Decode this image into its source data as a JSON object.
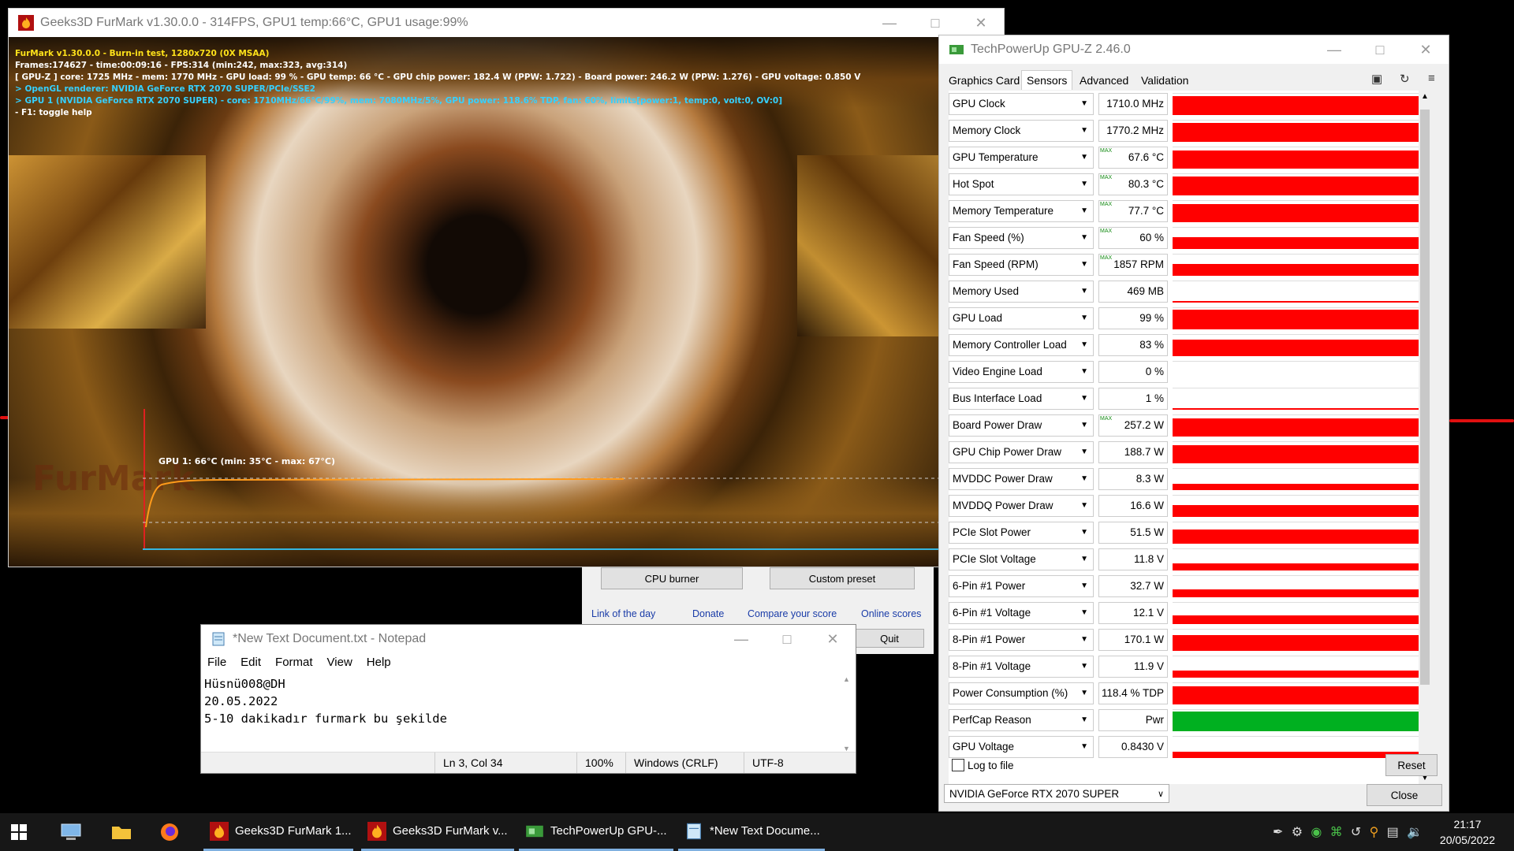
{
  "furmark": {
    "title": "Geeks3D FurMark v1.30.0.0 - 314FPS, GPU1 temp:66°C, GPU1 usage:99%",
    "hud": [
      "FurMark v1.30.0.0 - Burn-in test, 1280x720 (0X MSAA)",
      "Frames:174627 - time:00:09:16 - FPS:314 (min:242, max:323, avg:314)",
      "[ GPU-Z ] core: 1725 MHz - mem: 1770 MHz - GPU load: 99 % - GPU temp: 66 °C - GPU chip power: 182.4 W (PPW: 1.722) - Board power: 246.2 W (PPW: 1.276) - GPU voltage: 0.850 V",
      "> OpenGL renderer: NVIDIA GeForce RTX 2070 SUPER/PCIe/SSE2",
      "> GPU 1 (NVIDIA GeForce RTX 2070 SUPER) - core: 1710MHz/66°C/99%, mem: 7080MHz/5%, GPU power: 118.6% TDP, fan: 60%, limits[power:1, temp:0, volt:0, OV:0]",
      "- F1: toggle help"
    ],
    "graph_label": "GPU 1: 66°C (min: 35°C - max: 67°C)",
    "logo": "FurMark",
    "panel": {
      "cpu_burner": "CPU burner",
      "custom_preset": "Custom preset",
      "link_of_the_day": "Link of the day",
      "donate": "Donate",
      "compare": "Compare your score",
      "online_scores": "Online scores",
      "quit": "Quit"
    }
  },
  "gpuz": {
    "title": "TechPowerUp GPU-Z 2.46.0",
    "tabs": [
      "Graphics Card",
      "Sensors",
      "Advanced",
      "Validation"
    ],
    "active_tab": "Sensors",
    "sensors": [
      {
        "name": "GPU Clock",
        "value": "1710.0 MHz",
        "max": false,
        "level": 0.95,
        "color": "#ff0000"
      },
      {
        "name": "Memory Clock",
        "value": "1770.2 MHz",
        "max": false,
        "level": 0.95,
        "color": "#ff0000"
      },
      {
        "name": "GPU Temperature",
        "value": "67.6 °C",
        "max": true,
        "level": 0.9,
        "color": "#ff0000"
      },
      {
        "name": "Hot Spot",
        "value": "80.3 °C",
        "max": true,
        "level": 0.95,
        "color": "#ff0000"
      },
      {
        "name": "Memory Temperature",
        "value": "77.7 °C",
        "max": true,
        "level": 0.9,
        "color": "#ff0000"
      },
      {
        "name": "Fan Speed (%)",
        "value": "60 %",
        "max": true,
        "level": 0.6,
        "color": "#ff0000"
      },
      {
        "name": "Fan Speed (RPM)",
        "value": "1857 RPM",
        "max": true,
        "level": 0.6,
        "color": "#ff0000"
      },
      {
        "name": "Memory Used",
        "value": "469 MB",
        "max": false,
        "level": 0.06,
        "color": "#ff0000"
      },
      {
        "name": "GPU Load",
        "value": "99 %",
        "max": false,
        "level": 0.99,
        "color": "#ff0000"
      },
      {
        "name": "Memory Controller Load",
        "value": "83 %",
        "max": false,
        "level": 0.83,
        "color": "#ff0000"
      },
      {
        "name": "Video Engine Load",
        "value": "0 %",
        "max": false,
        "level": 0,
        "color": "#ff0000"
      },
      {
        "name": "Bus Interface Load",
        "value": "1 %",
        "max": false,
        "level": 0.02,
        "color": "#ff0000"
      },
      {
        "name": "Board Power Draw",
        "value": "257.2 W",
        "max": true,
        "level": 0.92,
        "color": "#ff0000"
      },
      {
        "name": "GPU Chip Power Draw",
        "value": "188.7 W",
        "max": false,
        "level": 0.9,
        "color": "#ff0000"
      },
      {
        "name": "MVDDC Power Draw",
        "value": "8.3 W",
        "max": false,
        "level": 0.3,
        "color": "#ff0000"
      },
      {
        "name": "MVDDQ Power Draw",
        "value": "16.6 W",
        "max": false,
        "level": 0.6,
        "color": "#ff0000"
      },
      {
        "name": "PCIe Slot Power",
        "value": "51.5 W",
        "max": false,
        "level": 0.7,
        "color": "#ff0000"
      },
      {
        "name": "PCIe Slot Voltage",
        "value": "11.8 V",
        "max": false,
        "level": 0.35,
        "color": "#ff0000"
      },
      {
        "name": "6-Pin #1 Power",
        "value": "32.7 W",
        "max": false,
        "level": 0.4,
        "color": "#ff0000"
      },
      {
        "name": "6-Pin #1 Voltage",
        "value": "12.1 V",
        "max": false,
        "level": 0.45,
        "color": "#ff0000"
      },
      {
        "name": "8-Pin #1 Power",
        "value": "170.1 W",
        "max": false,
        "level": 0.8,
        "color": "#ff0000"
      },
      {
        "name": "8-Pin #1 Voltage",
        "value": "11.9 V",
        "max": false,
        "level": 0.35,
        "color": "#ff0000"
      },
      {
        "name": "Power Consumption (%)",
        "value": "118.4 % TDP",
        "max": false,
        "level": 0.9,
        "color": "#ff0000"
      },
      {
        "name": "PerfCap Reason",
        "value": "Pwr",
        "max": false,
        "level": 1,
        "color": "#00b020"
      },
      {
        "name": "GPU Voltage",
        "value": "0.8430 V",
        "max": false,
        "level": 0.3,
        "color": "#ff0000"
      }
    ],
    "log_to_file": "Log to file",
    "reset": "Reset",
    "device": "NVIDIA GeForce RTX 2070 SUPER",
    "close": "Close"
  },
  "notepad": {
    "title": "*New Text Document.txt - Notepad",
    "menu": [
      "File",
      "Edit",
      "Format",
      "View",
      "Help"
    ],
    "text": "Hüsnü008@DH\n20.05.2022\n5-10 dakikadır furmark bu şekilde",
    "status": {
      "position": "Ln 3, Col 34",
      "zoom": "100%",
      "line_ending": "Windows (CRLF)",
      "encoding": "UTF-8"
    }
  },
  "taskbar": {
    "items": [
      {
        "label": "Geeks3D FurMark 1...",
        "icon": "furmark-icon"
      },
      {
        "label": "Geeks3D FurMark v...",
        "icon": "furmark-icon"
      },
      {
        "label": "TechPowerUp GPU-...",
        "icon": "gpuz-icon"
      },
      {
        "label": "*New Text Docume...",
        "icon": "notepad-icon"
      }
    ],
    "time": "21:17",
    "date": "20/05/2022"
  }
}
